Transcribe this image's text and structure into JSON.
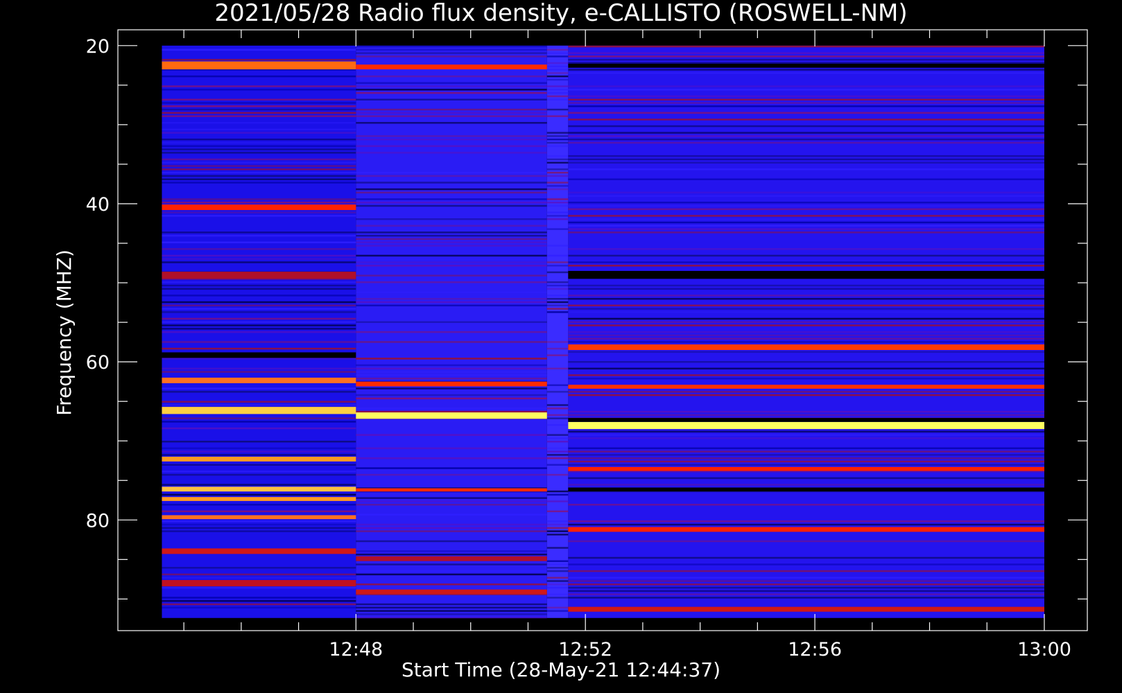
{
  "chart_data": {
    "type": "heatmap",
    "title": "2021/05/28  Radio flux density, e-CALLISTO (ROSWELL-NM)",
    "xlabel": "Start Time (28-May-21 12:44:37)",
    "ylabel": "Frequency (MHZ)",
    "x_ticks": [
      "12:48",
      "12:52",
      "12:56",
      "13:00"
    ],
    "y_ticks": [
      "20",
      "40",
      "60",
      "80"
    ],
    "y_tick_values": [
      20,
      40,
      60,
      80
    ],
    "x_tick_minutes": [
      48,
      52,
      56,
      60
    ],
    "x_range_minutes": [
      44.617,
      60
    ],
    "axis_x_range_minutes": [
      43.85,
      60.75
    ],
    "axis_y_range": [
      18,
      94
    ],
    "data_y_range": [
      20,
      92.4
    ],
    "segments": [
      {
        "start": 44.617,
        "end": 48.0,
        "base": "#1a10e8"
      },
      {
        "start": 48.0,
        "end": 51.33,
        "base": "#2a1cf4"
      },
      {
        "start": 51.33,
        "end": 51.7,
        "base": "#3a2cff"
      },
      {
        "start": 51.7,
        "end": 60.0,
        "base": "#2414ee"
      }
    ],
    "bands": [
      {
        "f0": 22.0,
        "f1": 23.0,
        "segments": [
          0
        ],
        "color": "#ff6a10"
      },
      {
        "f0": 22.4,
        "f1": 23.0,
        "segments": [
          1
        ],
        "color": "#ff2a00"
      },
      {
        "f0": 22.3,
        "f1": 22.8,
        "segments": [
          3
        ],
        "color": "#000000"
      },
      {
        "f0": 40.1,
        "f1": 40.8,
        "segments": [
          0
        ],
        "color": "#ff2200"
      },
      {
        "f0": 48.6,
        "f1": 49.5,
        "segments": [
          0
        ],
        "color": "#b0102a"
      },
      {
        "f0": 48.5,
        "f1": 49.5,
        "segments": [
          3
        ],
        "color": "#000000"
      },
      {
        "f0": 57.8,
        "f1": 58.5,
        "segments": [
          3
        ],
        "color": "#ff3a00"
      },
      {
        "f0": 58.8,
        "f1": 59.5,
        "segments": [
          0
        ],
        "color": "#000000"
      },
      {
        "f0": 62.0,
        "f1": 62.7,
        "segments": [
          0
        ],
        "color": "#ff7020"
      },
      {
        "f0": 62.5,
        "f1": 63.1,
        "segments": [
          1
        ],
        "color": "#ff2a00"
      },
      {
        "f0": 62.9,
        "f1": 63.4,
        "segments": [
          3
        ],
        "color": "#ff3000"
      },
      {
        "f0": 65.7,
        "f1": 66.6,
        "segments": [
          0
        ],
        "color": "#ffd040"
      },
      {
        "f0": 66.4,
        "f1": 67.2,
        "segments": [
          1
        ],
        "color": "#ffff60"
      },
      {
        "f0": 67.6,
        "f1": 68.5,
        "segments": [
          3
        ],
        "color": "#ffff60"
      },
      {
        "f0": 67.1,
        "f1": 67.6,
        "segments": [
          3
        ],
        "color": "#000000"
      },
      {
        "f0": 72.0,
        "f1": 72.6,
        "segments": [
          0
        ],
        "color": "#ff9a20"
      },
      {
        "f0": 73.3,
        "f1": 73.8,
        "segments": [
          3
        ],
        "color": "#ff2000"
      },
      {
        "f0": 75.8,
        "f1": 76.4,
        "segments": [
          0
        ],
        "color": "#ffc040"
      },
      {
        "f0": 76.0,
        "f1": 76.4,
        "segments": [
          1
        ],
        "color": "#ff2a00"
      },
      {
        "f0": 75.9,
        "f1": 76.4,
        "segments": [
          3
        ],
        "color": "#000000"
      },
      {
        "f0": 77.1,
        "f1": 77.6,
        "segments": [
          0
        ],
        "color": "#ff9a20"
      },
      {
        "f0": 79.4,
        "f1": 79.9,
        "segments": [
          0
        ],
        "color": "#ff7020"
      },
      {
        "f0": 80.9,
        "f1": 81.5,
        "segments": [
          3
        ],
        "color": "#ff2000"
      },
      {
        "f0": 83.6,
        "f1": 84.3,
        "segments": [
          0
        ],
        "color": "#d01818"
      },
      {
        "f0": 84.6,
        "f1": 85.2,
        "segments": [
          1
        ],
        "color": "#b0102a"
      },
      {
        "f0": 87.6,
        "f1": 88.4,
        "segments": [
          0
        ],
        "color": "#c01020"
      },
      {
        "f0": 88.8,
        "f1": 89.4,
        "segments": [
          1
        ],
        "color": "#d01818"
      },
      {
        "f0": 91.0,
        "f1": 91.6,
        "segments": [
          3
        ],
        "color": "#d01818"
      }
    ],
    "grid": false,
    "legend": "none"
  }
}
